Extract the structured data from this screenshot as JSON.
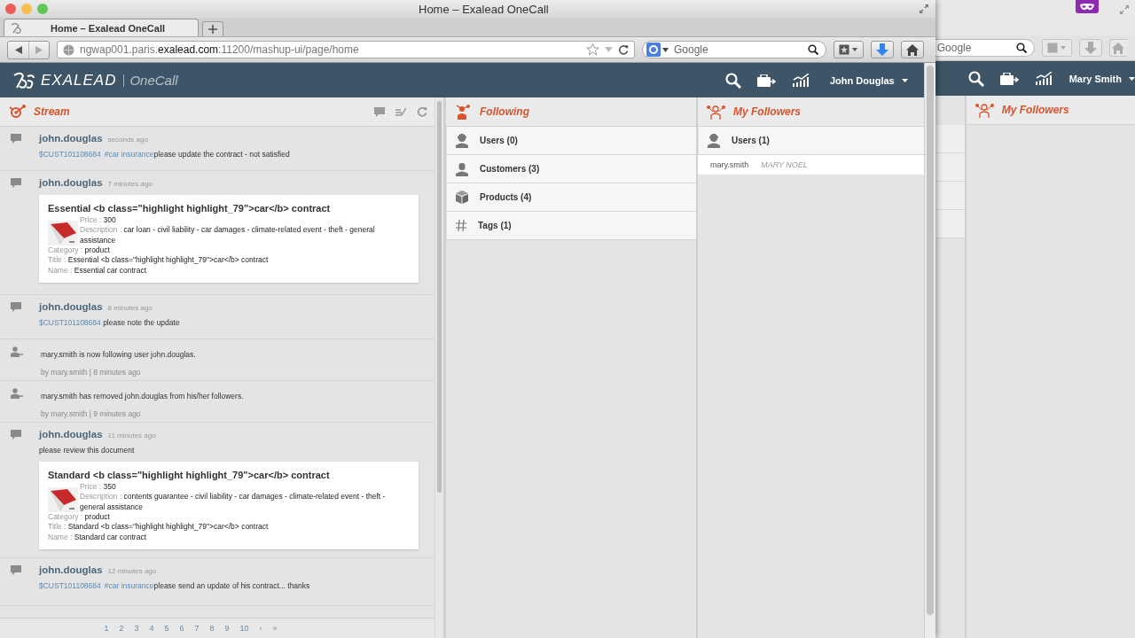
{
  "browser": {
    "window_title": "Home – Exalead OneCall",
    "tabs": [
      {
        "title": "Home – Exalead OneCall",
        "selected": true
      }
    ],
    "url": "ngwap001.paris.**exalead.com**:11200/mashup-ui/page/home",
    "search_placeholder": "Google"
  },
  "app": {
    "brand": "EXALEAD",
    "product": "OneCall",
    "user": "John Douglas"
  },
  "stream": {
    "title": "Stream",
    "items": [
      {
        "kind": "post",
        "user": "john.douglas",
        "time": "seconds ago",
        "message": [
          {
            "kind": "link",
            "text": "$CUST101108684"
          },
          {
            "kind": "link",
            "text": "#car insurance"
          },
          {
            "kind": "text",
            "text": "please update the contract - not satisfied"
          }
        ]
      },
      {
        "kind": "post",
        "user": "john.douglas",
        "time": "7 minutes ago",
        "card": {
          "title": "Essential <b class=\"highlight highlight_79\">car</b> contract",
          "side_fields": [
            {
              "label": "Price :",
              "value": "300"
            },
            {
              "label": "Description :",
              "value": "car loan - civil liability - car damages - climate-related event - theft - general assistance"
            }
          ],
          "fields": [
            {
              "label": "Category :",
              "value": "product"
            },
            {
              "label": "Title :",
              "value": "Essential <b class=\"highlight highlight_79\">car</b> contract"
            },
            {
              "label": "Name :",
              "value": "Essential car contract"
            }
          ]
        }
      },
      {
        "kind": "post",
        "user": "john.douglas",
        "time": "8 minutes ago",
        "message": [
          {
            "kind": "link",
            "text": "$CUST101108684"
          },
          {
            "kind": "text",
            "text": " please note the update"
          }
        ]
      },
      {
        "kind": "activity",
        "text": "mary.smith is now following user john.douglas.",
        "byline": "by mary.smith | 8 minutes ago"
      },
      {
        "kind": "activity",
        "text": "mary.smith has removed john.douglas from his/her followers.",
        "byline": "by mary.smith | 9 minutes ago"
      },
      {
        "kind": "post",
        "user": "john.douglas",
        "time": "11 minutes ago",
        "message": [
          {
            "kind": "text",
            "text": "please review this document"
          }
        ],
        "card": {
          "title": "Standard <b class=\"highlight highlight_79\">car</b> contract",
          "side_fields": [
            {
              "label": "Price :",
              "value": "350"
            },
            {
              "label": "Description :",
              "value": "contents guarantee - civil liability - car damages - climate-related event - theft - general assistance"
            }
          ],
          "fields": [
            {
              "label": "Category :",
              "value": "product"
            },
            {
              "label": "Title :",
              "value": "Standard <b class=\"highlight highlight_79\">car</b> contract"
            },
            {
              "label": "Name :",
              "value": "Standard car contract"
            }
          ]
        }
      },
      {
        "kind": "post",
        "user": "john.douglas",
        "time": "12 minutes ago",
        "message": [
          {
            "kind": "link",
            "text": "$CUST101108684"
          },
          {
            "kind": "link",
            "text": "#car insurance"
          },
          {
            "kind": "text",
            "text": "please send an update of his contract... thanks"
          }
        ]
      }
    ],
    "pages": [
      "1",
      "2",
      "3",
      "4",
      "5",
      "6",
      "7",
      "8",
      "9",
      "10",
      "‹",
      "»"
    ]
  },
  "following": {
    "title": "Following",
    "items": [
      {
        "kind": "users",
        "label": "Users (0)"
      },
      {
        "kind": "customers",
        "label": "Customers (3)"
      },
      {
        "kind": "products",
        "label": "Products (4)"
      },
      {
        "kind": "tags",
        "label": "Tags (1)"
      }
    ]
  },
  "followers": {
    "title": "My Followers",
    "group": "Users (1)",
    "rows": [
      {
        "login": "mary.smith",
        "name": "MARY NOEL"
      }
    ]
  },
  "back_window": {
    "search_placeholder": "Google",
    "user": "Mary Smith",
    "panel_title": "My Followers"
  }
}
